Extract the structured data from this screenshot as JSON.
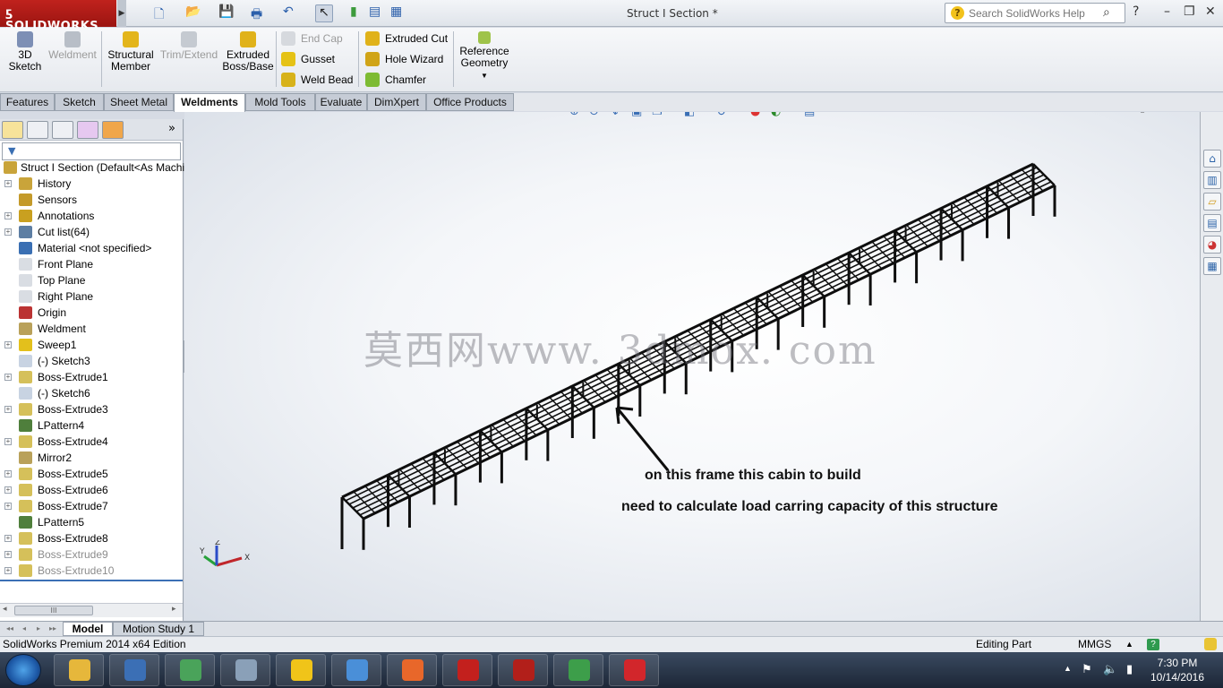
{
  "titlebar": {
    "brand": "SOLIDWORKS",
    "document_title": "Struct I Section *",
    "search_placeholder": "Search SolidWorks Help"
  },
  "command_manager": {
    "big_buttons": [
      {
        "label": "3D Sketch",
        "line1": "3D",
        "line2": "Sketch",
        "enabled": true,
        "color": "#7d8fb5"
      },
      {
        "label": "Weldment",
        "line1": "Weldment",
        "line2": "",
        "enabled": false,
        "color": "#b8bec7"
      },
      {
        "label": "Structural Member",
        "line1": "Structural",
        "line2": "Member",
        "enabled": true,
        "color": "#e3b51b"
      },
      {
        "label": "Trim/Extend",
        "line1": "Trim/Extend",
        "line2": "",
        "enabled": false,
        "color": "#c5cad1"
      },
      {
        "label": "Extruded Boss/Base",
        "line1": "Extruded",
        "line2": "Boss/Base",
        "enabled": true,
        "color": "#e0b21a"
      }
    ],
    "col1": [
      {
        "label": "End Cap",
        "enabled": false,
        "color": "#d6d9de"
      },
      {
        "label": "Gusset",
        "enabled": true,
        "color": "#e5c216"
      },
      {
        "label": "Weld Bead",
        "enabled": true,
        "color": "#d7b21a"
      }
    ],
    "col2": [
      {
        "label": "Extruded Cut",
        "enabled": true,
        "color": "#e0b21a"
      },
      {
        "label": "Hole Wizard",
        "enabled": true,
        "color": "#d0a418"
      },
      {
        "label": "Chamfer",
        "enabled": true,
        "color": "#7dbb33"
      }
    ],
    "reference_geometry": {
      "line1": "Reference",
      "line2": "Geometry"
    }
  },
  "tabs": [
    {
      "label": "Features",
      "active": false
    },
    {
      "label": "Sketch",
      "active": false
    },
    {
      "label": "Sheet Metal",
      "active": false
    },
    {
      "label": "Weldments",
      "active": true
    },
    {
      "label": "Mold Tools",
      "active": false
    },
    {
      "label": "Evaluate",
      "active": false
    },
    {
      "label": "DimXpert",
      "active": false
    },
    {
      "label": "Office Products",
      "active": false
    }
  ],
  "feature_tree": {
    "root": "Struct I Section  (Default<As Machined>)",
    "items": [
      {
        "label": "History",
        "expandable": true,
        "icon": "history-icon",
        "color": "#c9a43a",
        "dim": false
      },
      {
        "label": "Sensors",
        "expandable": false,
        "icon": "sensors-icon",
        "color": "#c49a2a",
        "dim": false
      },
      {
        "label": "Annotations",
        "expandable": true,
        "icon": "annotations-icon",
        "color": "#c9a020",
        "dim": false
      },
      {
        "label": "Cut list(64)",
        "expandable": true,
        "icon": "cut-list-icon",
        "color": "#5d7ea3",
        "dim": false
      },
      {
        "label": "Material <not specified>",
        "expandable": false,
        "icon": "material-icon",
        "color": "#3a6fb3",
        "dim": false
      },
      {
        "label": "Front Plane",
        "expandable": false,
        "icon": "plane-icon",
        "color": "#d9dde3",
        "dim": false
      },
      {
        "label": "Top Plane",
        "expandable": false,
        "icon": "plane-icon",
        "color": "#d9dde3",
        "dim": false
      },
      {
        "label": "Right Plane",
        "expandable": false,
        "icon": "plane-icon",
        "color": "#d9dde3",
        "dim": false
      },
      {
        "label": "Origin",
        "expandable": false,
        "icon": "origin-icon",
        "color": "#b33",
        "dim": false
      },
      {
        "label": "Weldment",
        "expandable": false,
        "icon": "weldment-icon",
        "color": "#b9a15a",
        "dim": false
      },
      {
        "label": "Sweep1",
        "expandable": true,
        "icon": "sweep-icon",
        "color": "#e3c01c",
        "dim": false
      },
      {
        "label": "(-) Sketch3",
        "expandable": false,
        "icon": "sketch-icon",
        "color": "#c8d3e2",
        "dim": false
      },
      {
        "label": "Boss-Extrude1",
        "expandable": true,
        "icon": "extrude-icon",
        "color": "#d5c05a",
        "dim": false
      },
      {
        "label": "(-) Sketch6",
        "expandable": false,
        "icon": "sketch-icon",
        "color": "#c8d3e2",
        "dim": false
      },
      {
        "label": "Boss-Extrude3",
        "expandable": true,
        "icon": "extrude-icon",
        "color": "#d5c05a",
        "dim": false
      },
      {
        "label": "LPattern4",
        "expandable": false,
        "icon": "pattern-icon",
        "color": "#4f7f3c",
        "dim": false
      },
      {
        "label": "Boss-Extrude4",
        "expandable": true,
        "icon": "extrude-icon",
        "color": "#d5c05a",
        "dim": false
      },
      {
        "label": "Mirror2",
        "expandable": false,
        "icon": "mirror-icon",
        "color": "#b9a15a",
        "dim": false
      },
      {
        "label": "Boss-Extrude5",
        "expandable": true,
        "icon": "extrude-icon",
        "color": "#d5c05a",
        "dim": false
      },
      {
        "label": "Boss-Extrude6",
        "expandable": true,
        "icon": "extrude-icon",
        "color": "#d5c05a",
        "dim": false
      },
      {
        "label": "Boss-Extrude7",
        "expandable": true,
        "icon": "extrude-icon",
        "color": "#d5c05a",
        "dim": false
      },
      {
        "label": "LPattern5",
        "expandable": false,
        "icon": "pattern-icon",
        "color": "#4f7f3c",
        "dim": false
      },
      {
        "label": "Boss-Extrude8",
        "expandable": true,
        "icon": "extrude-icon",
        "color": "#d5c05a",
        "dim": false
      },
      {
        "label": "Boss-Extrude9",
        "expandable": true,
        "icon": "extrude-icon",
        "color": "#d5c05a",
        "dim": true
      },
      {
        "label": "Boss-Extrude10",
        "expandable": true,
        "icon": "extrude-icon",
        "color": "#d5c05a",
        "dim": true
      }
    ],
    "scroll_thumb": "III"
  },
  "graphics": {
    "watermark": "莫西网www. 3dmox. com",
    "annotation_line1": "on this frame this cabin to build",
    "annotation_line2": "need to calculate load carring capacity of this structure",
    "triad": {
      "x": "X",
      "y": "Y",
      "z": "Z"
    }
  },
  "model_tabs": [
    {
      "label": "Model",
      "active": true
    },
    {
      "label": "Motion Study 1",
      "active": false
    }
  ],
  "statusbar": {
    "edition": "SolidWorks Premium 2014 x64 Edition",
    "mode": "Editing Part",
    "units": "MMGS",
    "units_arrow": "▲"
  },
  "taskbar": {
    "apps": [
      {
        "name": "file-explorer",
        "color": "#e6b73b"
      },
      {
        "name": "3ds-launcher",
        "color": "#3b6fb5"
      },
      {
        "name": "image-viewer",
        "color": "#4aa35a"
      },
      {
        "name": "calculator",
        "color": "#8aa0b8"
      },
      {
        "name": "autocad-app",
        "color": "#f0c419"
      },
      {
        "name": "paint-app",
        "color": "#4a8fd8"
      },
      {
        "name": "firefox",
        "color": "#e8672a"
      },
      {
        "name": "adobe-app",
        "color": "#c3201d"
      },
      {
        "name": "acrobat-app",
        "color": "#b21f1a"
      },
      {
        "name": "chrome",
        "color": "#3d9e4a"
      },
      {
        "name": "solidworks-app",
        "color": "#d2262b"
      }
    ],
    "time": "7:30 PM",
    "date": "10/14/2016"
  }
}
